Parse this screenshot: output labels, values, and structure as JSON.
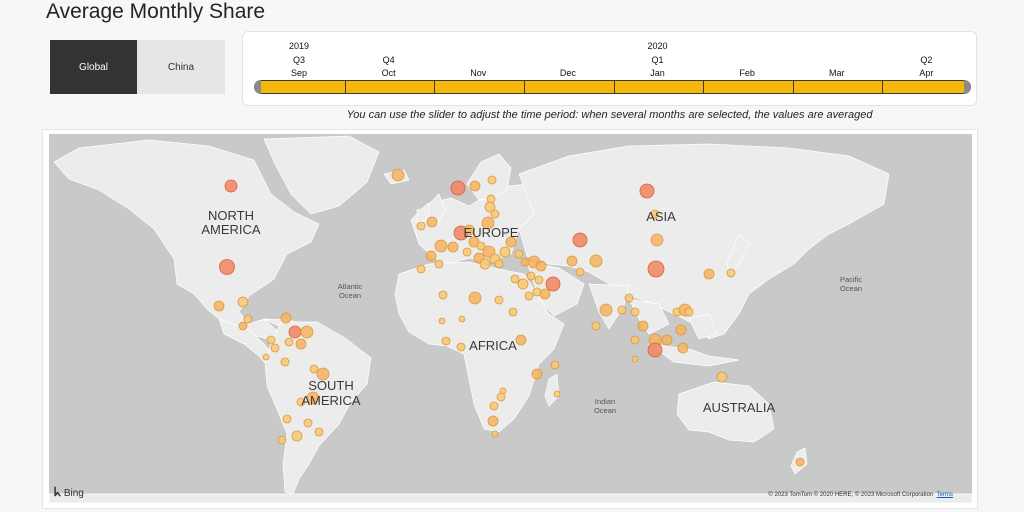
{
  "title": "Average Monthly Share",
  "toggle": {
    "global": "Global",
    "china": "China"
  },
  "slider": {
    "years": [
      {
        "label": "2019",
        "at": 0
      },
      {
        "label": "2020",
        "at": 4
      }
    ],
    "quarters": [
      {
        "label": "Q3",
        "at": 0
      },
      {
        "label": "Q4",
        "at": 1
      },
      {
        "label": "Q1",
        "at": 4
      },
      {
        "label": "Q2",
        "at": 7
      }
    ],
    "months": [
      "Sep",
      "Oct",
      "Nov",
      "Dec",
      "Jan",
      "Feb",
      "Mar",
      "Apr"
    ]
  },
  "hint": "You can use the slider to adjust the time period: when several months are selected, the values are averaged",
  "map": {
    "continents": [
      "NORTH AMERICA",
      "EUROPE",
      "ASIA",
      "AFRICA",
      "SOUTH AMERICA",
      "AUSTRALIA"
    ],
    "oceans": [
      "Atlantic Ocean",
      "Pacific Ocean",
      "Indian Ocean"
    ],
    "bing": "Bing",
    "copyright": "© 2023 TomTom © 2020 HERE, © 2023 Microsoft Corporation",
    "terms": "Terms"
  },
  "colors": {
    "high": "#f28560",
    "mid": "#f7b15f",
    "low": "#f9c874",
    "toggle_active": "#333333",
    "slider": "#f4b80a"
  }
}
